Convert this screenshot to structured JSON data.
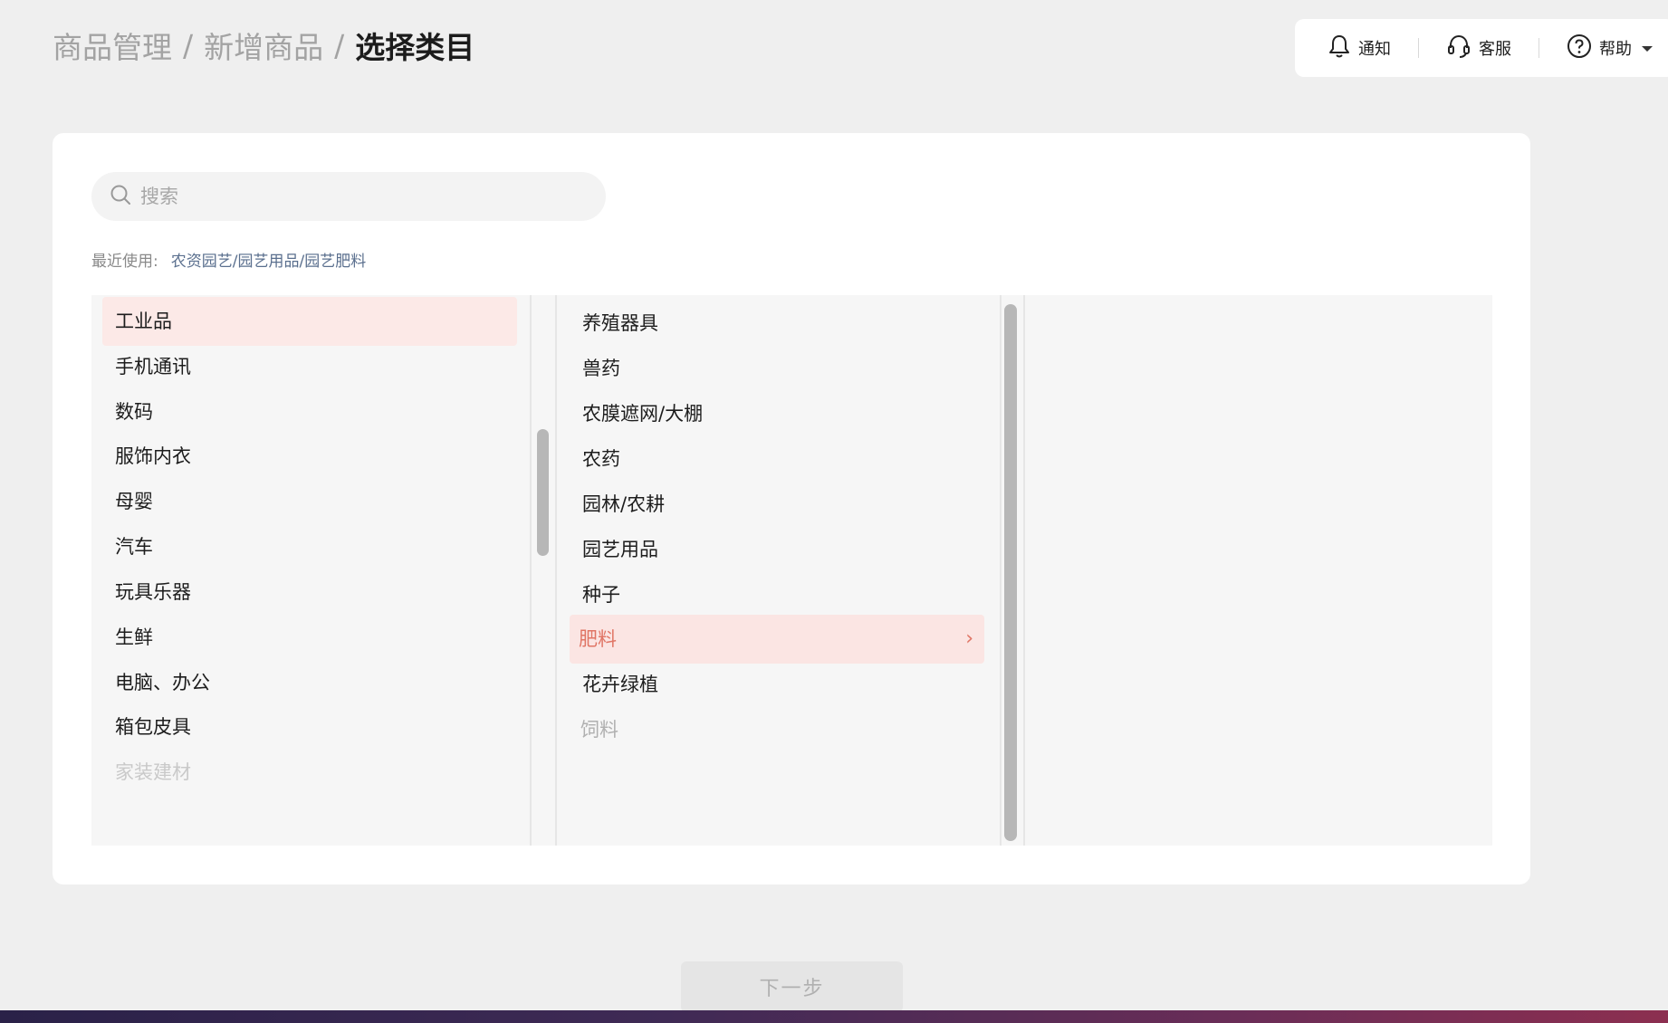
{
  "breadcrumb": [
    "商品管理",
    "新增商品",
    "选择类目"
  ],
  "toolbar": {
    "notify": "通知",
    "service": "客服",
    "help": "帮助"
  },
  "search": {
    "placeholder": "搜索"
  },
  "recent": {
    "label": "最近使用:",
    "link": "农资园艺/园艺用品/园艺肥料"
  },
  "columns": {
    "level1": [
      "工业品",
      "手机通讯",
      "数码",
      "服饰内衣",
      "母婴",
      "汽车",
      "玩具乐器",
      "生鲜",
      "电脑、办公",
      "箱包皮具",
      "家装建材"
    ],
    "level2": [
      "养殖器具",
      "兽药",
      "农膜遮网/大棚",
      "农药",
      "园林/农耕",
      "园艺用品",
      "种子",
      "肥料",
      "花卉绿植",
      "饲料"
    ]
  },
  "next_button": "下一步",
  "colors": {
    "accent": "#e07565",
    "active_bg": "#fce9e7"
  }
}
